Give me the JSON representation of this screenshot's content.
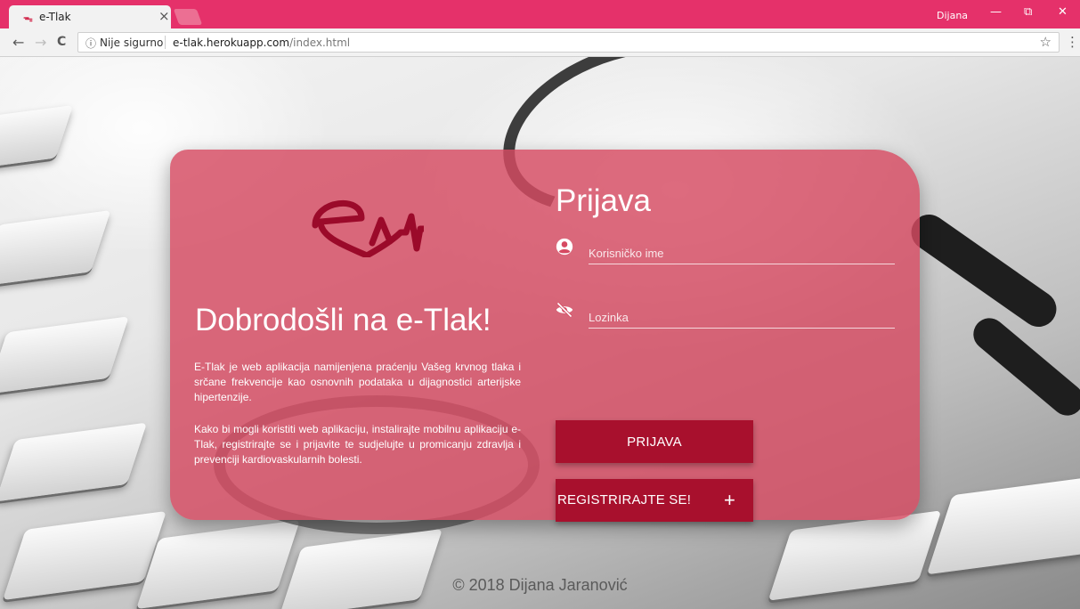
{
  "browser": {
    "tab_title": "e-Tlak",
    "tab_icon": "heartbeat-logo-icon",
    "tab_close": "×",
    "profile_name": "Dijana",
    "window_controls": {
      "minimize": "—",
      "maximize": "⧉",
      "close": "✕"
    },
    "nav": {
      "back": "←",
      "forward": "→",
      "reload": "C"
    },
    "security_label": "Nije sigurno",
    "url_host": "e-tlak.herokuapp.com",
    "url_path": "/index.html",
    "bookmark_star": "☆",
    "menu": "⋮"
  },
  "welcome": {
    "title": "Dobrodošli na e-Tlak!",
    "paragraph1": "E-Tlak je web aplikacija namijenjena praćenju Vašeg krvnog tlaka i srčane frekvencije kao osnovnih podataka u dijagnostici arterijske hipertenzije.",
    "paragraph2": "Kako bi mogli koristiti web aplikaciju, instalirajte mobilnu aplikaciju e-Tlak, registrirajte se i prijavite te sudjelujte u promicanju zdravlja i prevenciji kardiovaskularnih bolesti."
  },
  "login": {
    "title": "Prijava",
    "username_placeholder": "Korisničko ime",
    "username_icon": "account-circle-icon",
    "password_placeholder": "Lozinka",
    "password_icon": "eye-off-icon",
    "login_button": "PRIJAVA",
    "register_button": "REGISTRIRAJTE SE!",
    "register_plus": "+"
  },
  "footer": {
    "copyright": "© 2018 Dijana Jaranović"
  },
  "colors": {
    "browser_accent": "#e5316a",
    "card": "#d64a62",
    "button": "#a8102d",
    "logo": "#9b0a2a"
  }
}
